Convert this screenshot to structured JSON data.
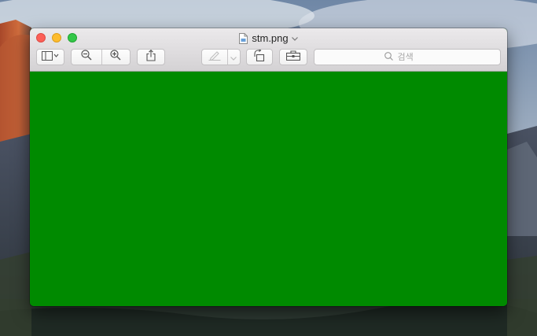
{
  "window": {
    "title": "stm.png",
    "content_color": "#008a00"
  },
  "toolbar": {
    "sidebar_button": "sidebar-icon",
    "zoom_out_button": "zoom-out-icon",
    "zoom_in_button": "zoom-in-icon",
    "share_button": "share-icon",
    "markup_button": "pen-icon",
    "rotate_button": "rotate-icon",
    "toolbox_button": "toolbox-icon"
  },
  "search": {
    "placeholder": "검색"
  },
  "colors": {
    "close": "#fc5f57",
    "minimize": "#fdbc2e",
    "maximize": "#33c748",
    "titlebar": "#e0dee0",
    "image": "#008a00"
  }
}
